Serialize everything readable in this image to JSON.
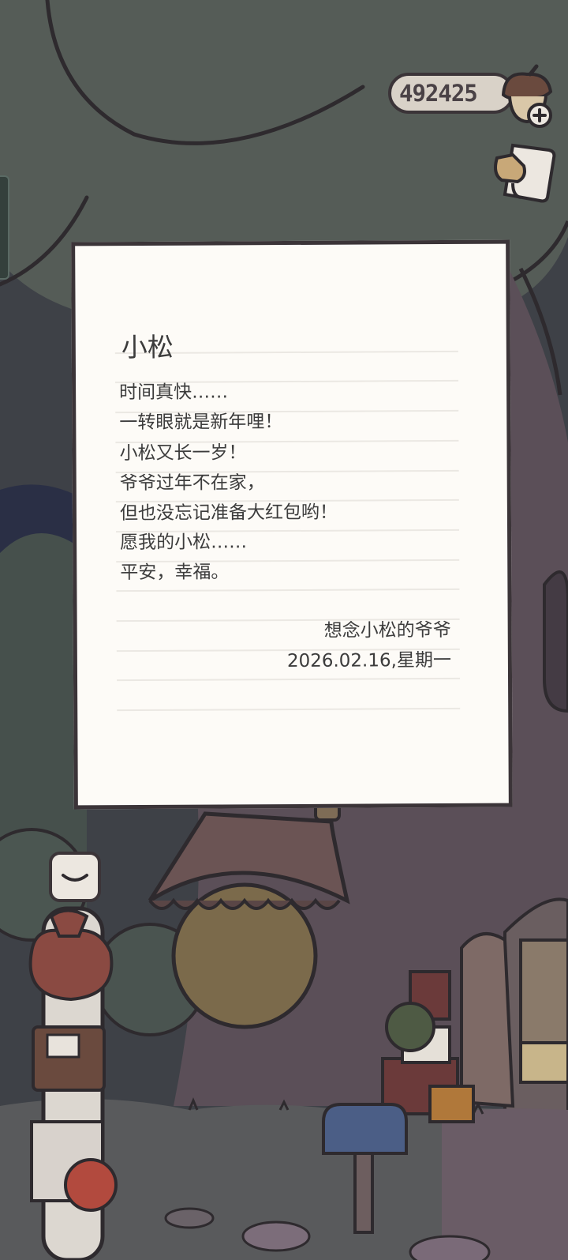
{
  "counter": {
    "value": "492425"
  },
  "letter": {
    "greeting": "小松",
    "lines": [
      "时间真快……",
      "一转眼就是新年哩！",
      "小松又长一岁！",
      "爷爷过年不在家，",
      "但也没忘记准备大红包哟！",
      "愿我的小松……",
      "平安，幸福。"
    ],
    "signature": "想念小松的爷爷",
    "date": "2026.02.16,星期一"
  },
  "icons": {
    "acorn": "acorn-add-icon",
    "side_button": "card-clip-icon",
    "mail": "mail-icon"
  }
}
